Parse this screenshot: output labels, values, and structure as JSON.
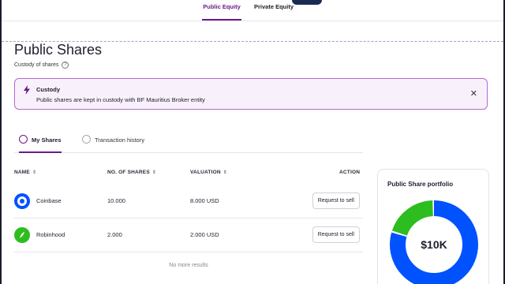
{
  "top_tabs": {
    "public": "Public Equity",
    "private": "Private Equity"
  },
  "page": {
    "title": "Public Shares",
    "subtitle": "Custody of shares",
    "help_glyph": "?"
  },
  "banner": {
    "title": "Custody",
    "text": "Public shares are kept in custody with BF Mauritius Broker entity",
    "close_glyph": "✕"
  },
  "tabs": {
    "my_shares": "My Shares",
    "history": "Transaction history"
  },
  "table": {
    "headers": {
      "name": "NAME",
      "shares": "NO. OF SHARES",
      "valuation": "VALUATION",
      "action": "ACTION"
    },
    "sort_glyph": "⇕",
    "rows": [
      {
        "name": "Coinbase",
        "shares": "10.000",
        "valuation": "8.000 USD",
        "action": "Request to sell",
        "icon": "coinbase-logo"
      },
      {
        "name": "Robinhood",
        "shares": "2.000",
        "valuation": "2.000 USD",
        "action": "Request to sell",
        "icon": "robinhood-logo"
      }
    ],
    "footer": "No more results"
  },
  "portfolio": {
    "title": "Public Share portfolio",
    "total": "$10K",
    "segments": [
      {
        "share": 0.8,
        "color": "#0052ff"
      },
      {
        "share": 0.2,
        "color": "#2dbd1f"
      }
    ]
  },
  "colors": {
    "accent": "#6a1b8a",
    "banner_border": "#b569cf",
    "coinbase": "#0052ff",
    "robinhood": "#2dbd1f"
  }
}
